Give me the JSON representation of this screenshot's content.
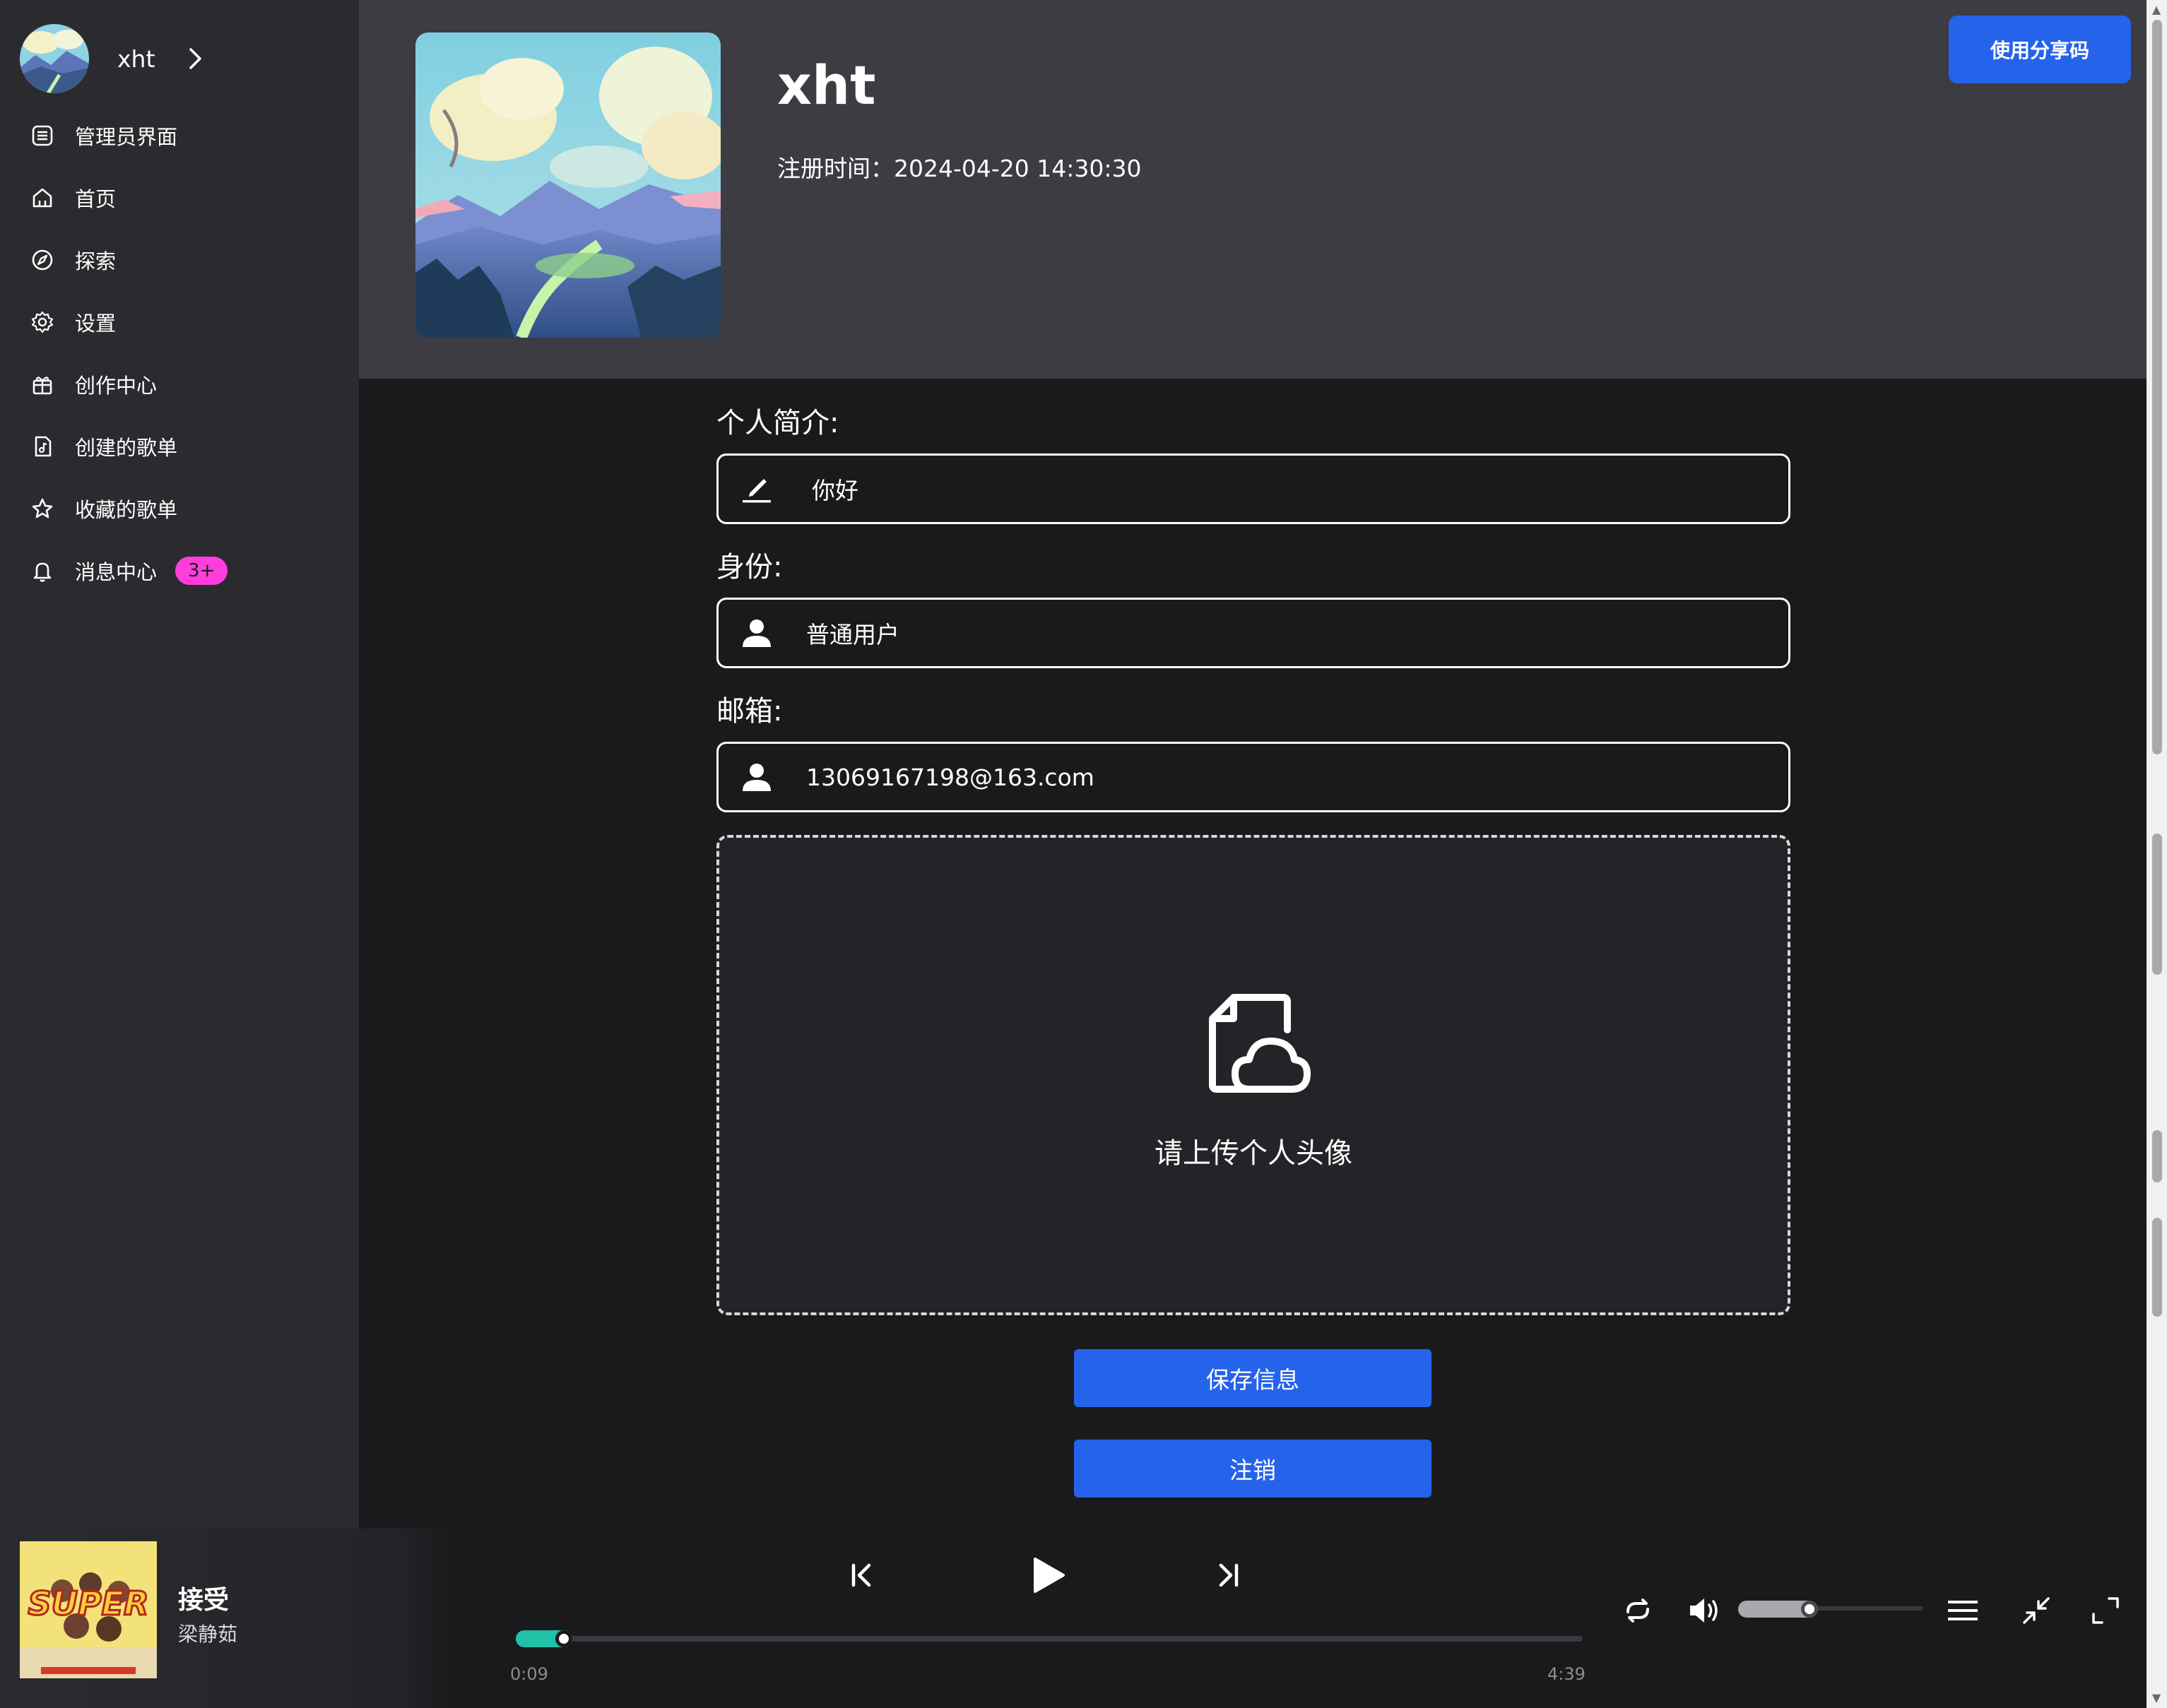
{
  "user": {
    "name": "xht",
    "registered": "注册时间：2024-04-20 14:30:30"
  },
  "header": {
    "share_button": "使用分享码"
  },
  "sidebar": {
    "items": [
      {
        "label": "管理员界面",
        "icon": "list-icon"
      },
      {
        "label": "首页",
        "icon": "home-icon"
      },
      {
        "label": "探索",
        "icon": "compass-icon"
      },
      {
        "label": "设置",
        "icon": "gear-icon"
      },
      {
        "label": "创作中心",
        "icon": "gift-icon"
      },
      {
        "label": "创建的歌单",
        "icon": "music-file-icon"
      },
      {
        "label": "收藏的歌单",
        "icon": "star-icon"
      },
      {
        "label": "消息中心",
        "icon": "bell-icon",
        "badge": "3+"
      }
    ]
  },
  "form": {
    "bio_label": "个人简介:",
    "bio_value": "你好",
    "role_label": "身份:",
    "role_value": "普通用户",
    "email_label": "邮箱:",
    "email_value": "13069167198@163.com",
    "upload_text": "请上传个人头像",
    "save_button": "保存信息",
    "logout_button": "注销"
  },
  "player": {
    "song_title": "接受",
    "artist": "梁静茹",
    "album_art_text": "SUPER",
    "current_time": "0:09",
    "total_time": "4:39",
    "progress": 0.032,
    "volume": 0.24
  },
  "colors": {
    "accent": "#2563eb",
    "badge": "#ff3ddb",
    "progress": "#20c1a7",
    "sidebar_bg": "#2b2b2f",
    "header_bg": "#3c3c42",
    "main_bg": "#1a1a1d"
  }
}
